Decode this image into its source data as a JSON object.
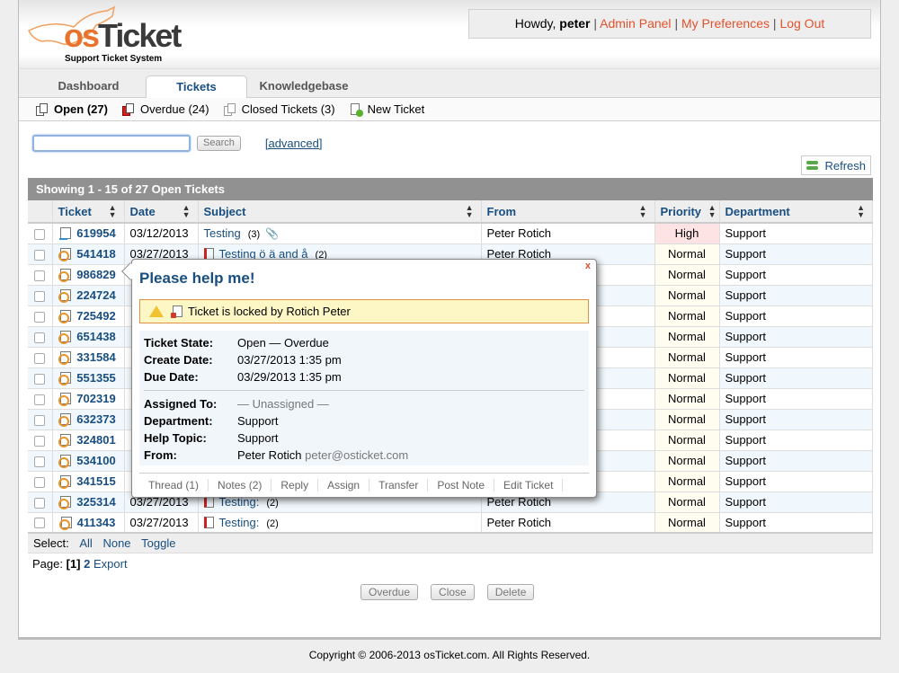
{
  "header": {
    "logo_brand_os": "os",
    "logo_brand_ticket": "Ticket",
    "logo_tagline": "Support Ticket System",
    "greeting": "Howdy,",
    "username": "peter",
    "links": [
      "Admin Panel",
      "My Preferences",
      "Log Out"
    ],
    "separator": "|"
  },
  "nav": {
    "tabs": [
      {
        "label": "Dashboard",
        "active": false
      },
      {
        "label": "Tickets",
        "active": true
      },
      {
        "label": "Knowledgebase",
        "active": false
      }
    ]
  },
  "subnav": {
    "items": [
      {
        "label": "Open (27)",
        "icon": "open-tickets-icon",
        "active": true
      },
      {
        "label": "Overdue (24)",
        "icon": "overdue-tickets-icon",
        "active": false
      },
      {
        "label": "Closed Tickets (3)",
        "icon": "closed-tickets-icon",
        "active": false
      },
      {
        "label": "New Ticket",
        "icon": "new-ticket-icon",
        "active": false
      }
    ]
  },
  "search": {
    "value": "",
    "placeholder": "",
    "button": "Search",
    "advanced": "[advanced]"
  },
  "refresh_label": "Refresh",
  "tickets": {
    "caption": "Showing  1 - 15 of 27   Open Tickets",
    "columns": [
      "Ticket",
      "Date",
      "Subject",
      "From",
      "Priority",
      "Department"
    ],
    "rows": [
      {
        "id": "619954",
        "source": "web",
        "date": "03/12/2013",
        "subject": "Testing",
        "count": "(3)",
        "attachment": true,
        "overdue": false,
        "from": "Peter Rotich",
        "priority": "High",
        "department": "Support"
      },
      {
        "id": "541418",
        "source": "email",
        "date": "03/27/2013",
        "subject": "Testing ö ä and å",
        "count": "(2)",
        "attachment": false,
        "overdue": true,
        "from": "Peter Rotich",
        "priority": "Normal",
        "department": "Support"
      },
      {
        "id": "986829",
        "source": "email",
        "date": "",
        "subject": "",
        "count": "",
        "overdue": false,
        "from": "",
        "priority": "Normal",
        "department": "Support"
      },
      {
        "id": "224724",
        "source": "email",
        "date": "",
        "subject": "",
        "count": "",
        "overdue": false,
        "from": "",
        "priority": "Normal",
        "department": "Support"
      },
      {
        "id": "725492",
        "source": "email",
        "date": "",
        "subject": "",
        "count": "",
        "overdue": false,
        "from": "",
        "priority": "Normal",
        "department": "Support"
      },
      {
        "id": "651438",
        "source": "email",
        "date": "",
        "subject": "",
        "count": "",
        "overdue": false,
        "from": "",
        "priority": "Normal",
        "department": "Support"
      },
      {
        "id": "331584",
        "source": "email",
        "date": "",
        "subject": "",
        "count": "",
        "overdue": false,
        "from": "",
        "priority": "Normal",
        "department": "Support"
      },
      {
        "id": "551355",
        "source": "email",
        "date": "",
        "subject": "",
        "count": "",
        "overdue": false,
        "from": "",
        "priority": "Normal",
        "department": "Support"
      },
      {
        "id": "702319",
        "source": "email",
        "date": "",
        "subject": "",
        "count": "",
        "overdue": false,
        "from": "",
        "priority": "Normal",
        "department": "Support"
      },
      {
        "id": "632373",
        "source": "email",
        "date": "",
        "subject": "",
        "count": "",
        "overdue": false,
        "from": "",
        "priority": "Normal",
        "department": "Support"
      },
      {
        "id": "324801",
        "source": "email",
        "date": "",
        "subject": "",
        "count": "",
        "overdue": false,
        "from": "",
        "priority": "Normal",
        "department": "Support"
      },
      {
        "id": "534100",
        "source": "email",
        "date": "",
        "subject": "",
        "count": "",
        "overdue": false,
        "from": "",
        "priority": "Normal",
        "department": "Support"
      },
      {
        "id": "341515",
        "source": "email",
        "date": "",
        "subject": "",
        "count": "",
        "overdue": false,
        "from": "",
        "priority": "Normal",
        "department": "Support"
      },
      {
        "id": "325314",
        "source": "email",
        "date": "03/27/2013",
        "subject": "Testing:",
        "count": "(2)",
        "overdue": true,
        "from": "Peter Rotich",
        "priority": "Normal",
        "department": "Support"
      },
      {
        "id": "411343",
        "source": "email",
        "date": "03/27/2013",
        "subject": "Testing:",
        "count": "(2)",
        "overdue": true,
        "from": "Peter Rotich",
        "priority": "Normal",
        "department": "Support"
      }
    ],
    "select_label": "Select:",
    "select_links": [
      "All",
      "None",
      "Toggle"
    ]
  },
  "pager": {
    "label": "Page:",
    "current": "[1]",
    "next": "2",
    "export": "Export"
  },
  "actions": [
    "Overdue",
    "Close",
    "Delete"
  ],
  "popup": {
    "title": "Please help me!",
    "close": "x",
    "lock_notice": "Ticket is locked by Rotich Peter",
    "details": [
      {
        "label": "Ticket State:",
        "value": "Open — Overdue"
      },
      {
        "label": "Create Date:",
        "value": "03/27/2013 1:35 pm"
      },
      {
        "label": "Due Date:",
        "value": "03/29/2013 1:35 pm"
      }
    ],
    "assignment": [
      {
        "label": "Assigned To:",
        "value": "— Unassigned —"
      },
      {
        "label": "Department:",
        "value": "Support"
      },
      {
        "label": "Help Topic:",
        "value": "Support"
      },
      {
        "label": "From:",
        "value": "Peter Rotich",
        "email": "peter@osticket.com"
      }
    ],
    "tabs": [
      "Thread (1)",
      "Notes (2)",
      "Reply",
      "Assign",
      "Transfer",
      "Post Note",
      "Edit Ticket"
    ]
  },
  "footer": "Copyright © 2006-2013 osTicket.com.  All Rights Reserved.",
  "colors": {
    "accent_link": "#184e81",
    "header_link": "#e2522c",
    "high_priority_bg": "#fde3e3",
    "caption_bg": "#919191"
  }
}
